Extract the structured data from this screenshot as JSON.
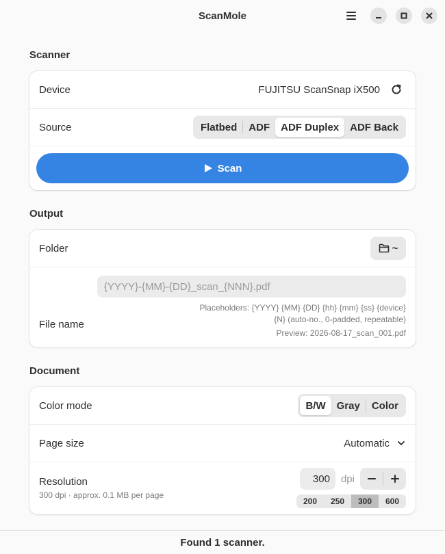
{
  "window": {
    "title": "ScanMole",
    "menu_icon": "hamburger-menu-icon",
    "minimize_icon": "minimize-icon",
    "maximize_icon": "maximize-icon",
    "close_icon": "close-icon"
  },
  "scanner": {
    "section_title": "Scanner",
    "device_label": "Device",
    "device_value": "FUJITSU ScanSnap iX500",
    "refresh_icon": "refresh-icon",
    "source_label": "Source",
    "source_options": [
      "Flatbed",
      "ADF",
      "ADF Duplex",
      "ADF Back"
    ],
    "source_selected": "ADF Duplex",
    "scan_label": "Scan",
    "scan_icon": "play-icon"
  },
  "output": {
    "section_title": "Output",
    "folder_label": "Folder",
    "folder_value": "~",
    "folder_icon": "folder-icon",
    "filename_label": "File name",
    "filename_placeholder": "{YYYY}-{MM}-{DD}_scan_{NNN}.pdf",
    "filename_value": "",
    "placeholders_line1": "Placeholders: {YYYY} {MM} {DD} {hh} {mm} {ss} {device}",
    "placeholders_line2": "{N} (auto-no., 0-padded, repeatable)",
    "preview": "Preview: 2026-08-17_scan_001.pdf"
  },
  "document": {
    "section_title": "Document",
    "color_mode_label": "Color mode",
    "color_modes": [
      "B/W",
      "Gray",
      "Color"
    ],
    "color_mode_selected": "B/W",
    "page_size_label": "Page size",
    "page_size_value": "Automatic",
    "page_size_icon": "chevron-down-icon",
    "resolution_label": "Resolution",
    "resolution_subtitle": "300 dpi · approx. 0.1 MB per page",
    "resolution_value": "300",
    "resolution_unit": "dpi",
    "decrement_icon": "minus-icon",
    "increment_icon": "plus-icon",
    "resolution_presets": [
      "200",
      "250",
      "300",
      "600"
    ],
    "resolution_preset_selected": "300"
  },
  "status": {
    "text": "Found 1 scanner."
  },
  "colors": {
    "accent": "#3584e4",
    "background": "#fafafa",
    "card": "#ffffff"
  }
}
